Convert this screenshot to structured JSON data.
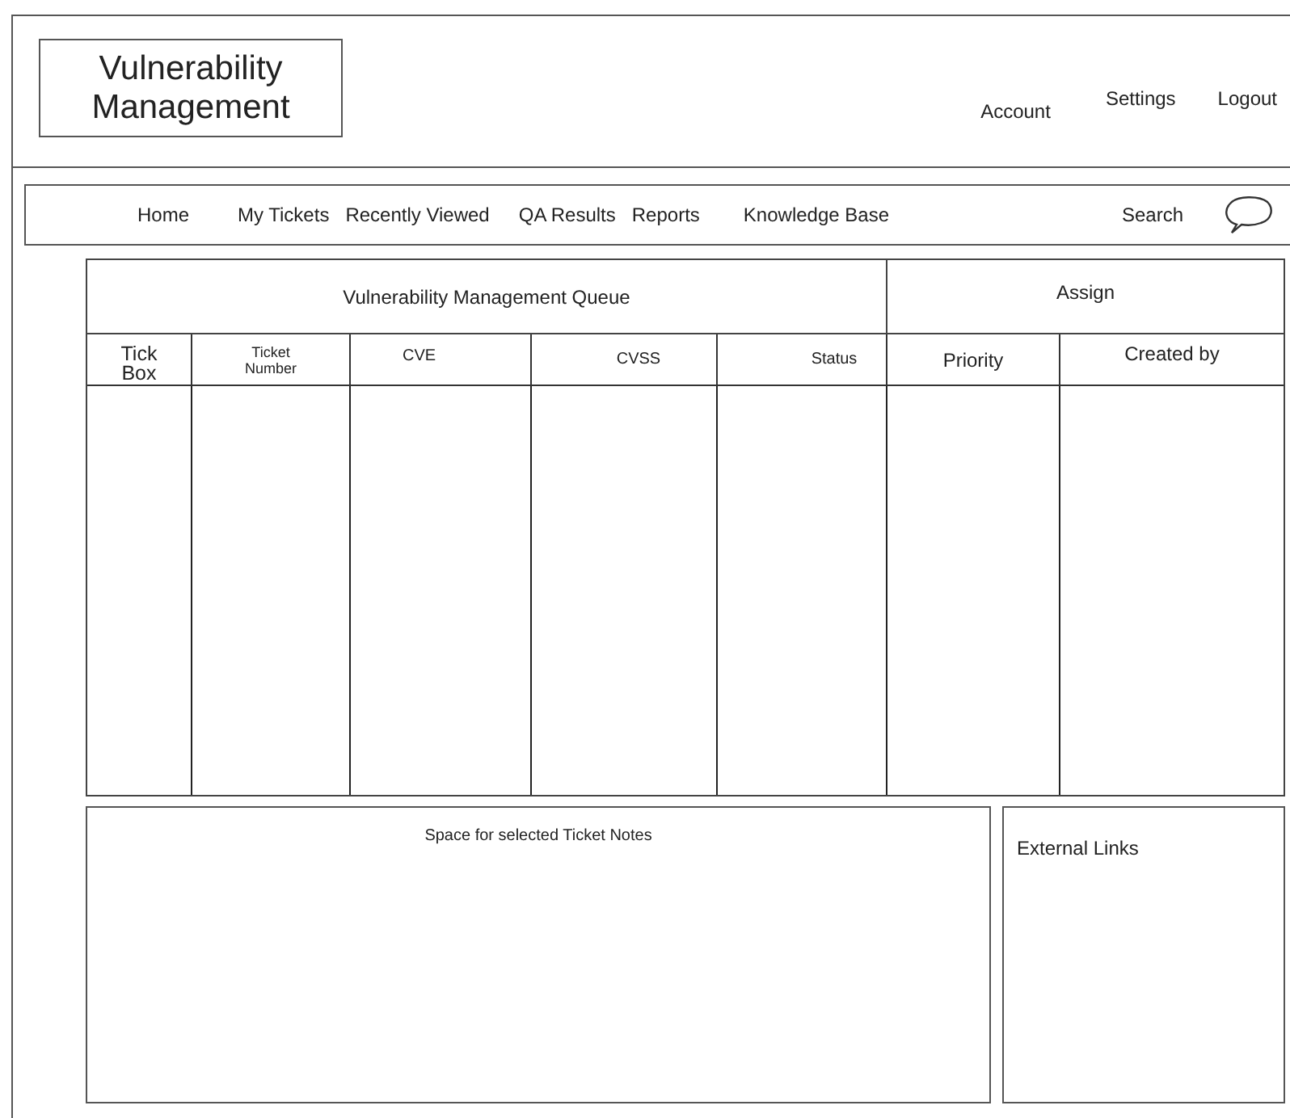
{
  "logo": {
    "text": "Vulnerability Management"
  },
  "top_links": [
    "Account",
    "Settings",
    "Logout"
  ],
  "nav": {
    "items": [
      "Home",
      "My Tickets",
      "Recently Viewed",
      "QA Results",
      "Reports",
      "Knowledge Base"
    ],
    "search": "Search"
  },
  "table": {
    "title": "Vulnerability Management Queue",
    "side_title": "Assign",
    "columns": [
      "Tick Box",
      "Ticket Number",
      "CVE",
      "CVSS",
      "Status",
      "Priority",
      "Created by"
    ]
  },
  "notes_panel": {
    "title": "Space for selected Ticket Notes"
  },
  "links_panel": {
    "title": "External Links"
  }
}
